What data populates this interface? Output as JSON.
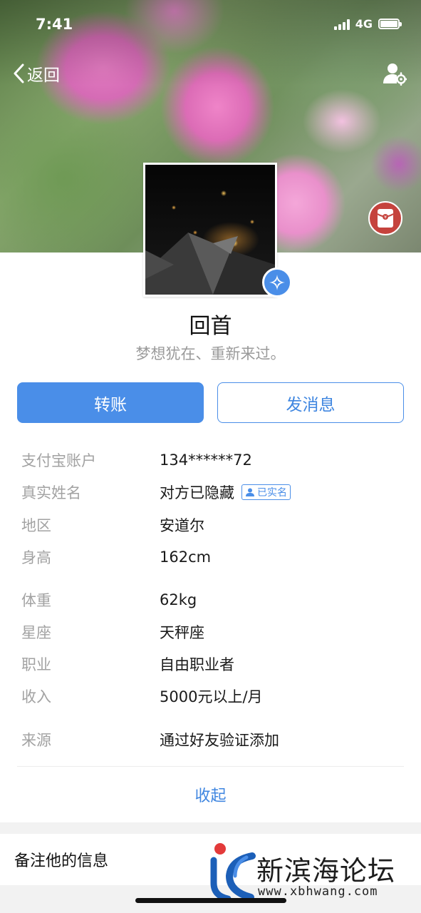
{
  "status_bar": {
    "time": "7:41",
    "network": "4G"
  },
  "nav": {
    "back_label": "返回"
  },
  "profile": {
    "name": "回首",
    "signature": "梦想犹在、重新来过。"
  },
  "actions": {
    "transfer_label": "转账",
    "message_label": "发消息"
  },
  "info": [
    {
      "label": "支付宝账户",
      "value": "134******72"
    },
    {
      "label": "真实姓名",
      "value": "对方已隐藏",
      "tag": "已实名"
    },
    {
      "label": "地区",
      "value": "安道尔"
    },
    {
      "label": "身高",
      "value": "162cm"
    },
    {
      "label": "体重",
      "value": "62kg"
    },
    {
      "label": "星座",
      "value": "天秤座"
    },
    {
      "label": "职业",
      "value": "自由职业者"
    },
    {
      "label": "收入",
      "value": "5000元以上/月"
    },
    {
      "label": "来源",
      "value": "通过好友验证添加"
    }
  ],
  "collapse_label": "收起",
  "remark_label": "备注他的信息",
  "watermark": {
    "title": "新滨海论坛",
    "url": "www.xbhwang.com"
  },
  "colors": {
    "accent": "#4a8ee8",
    "label_gray": "#a2a2a2",
    "red_packet": "#c5433d"
  },
  "icons": [
    "chevron-left-icon",
    "user-settings-icon",
    "red-packet-icon",
    "verified-star-icon",
    "realname-person-icon"
  ]
}
